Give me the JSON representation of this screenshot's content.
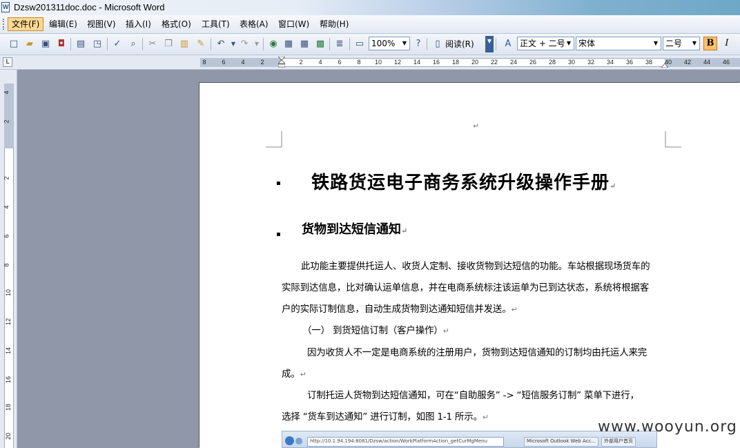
{
  "window": {
    "title": "Dzsw201311doc.doc - Microsoft Word"
  },
  "menu": [
    "文件(F)",
    "编辑(E)",
    "视图(V)",
    "插入(I)",
    "格式(O)",
    "工具(T)",
    "表格(A)",
    "窗口(W)",
    "帮助(H)"
  ],
  "toolbar": {
    "zoom": "100%",
    "read_label": "阅读(R)",
    "style": "正文 + 二号",
    "font": "宋体",
    "font_size": "二号",
    "bold_label": "B",
    "italic_label": "I"
  },
  "ruler": {
    "h_ticks": [
      "8",
      "6",
      "4",
      "2",
      "2",
      "4",
      "6",
      "8",
      "10",
      "12",
      "14",
      "16",
      "18",
      "20",
      "22",
      "24",
      "26",
      "28",
      "30",
      "32",
      "34",
      "36",
      "38",
      "40",
      "42",
      "44",
      "46"
    ],
    "v_ticks": [
      "4",
      "2",
      "2",
      "4",
      "6",
      "8",
      "10",
      "12",
      "14",
      "16",
      "18",
      "20"
    ]
  },
  "document": {
    "heading1": "铁路货运电子商务系统升级操作手册",
    "heading2": "货物到达短信通知",
    "lines": [
      "此功能主要提供托运人、收货人定制、接收货物到达短信的功能。车站根据现场货车的",
      "实际到达信息，比对确认运单信息，并在电商系统标注该运单为已到达状态，系统将根据客",
      "户的实际订制信息，自动生成货物到达通知短信并发送。",
      "（一）  到货短信订制（客户操作）",
      "因为收货人不一定是电商系统的注册用户，货物到达短信通知的订制均由托运人来完",
      "成。",
      "订制托运人货物到达短信通知，可在“自助服务” -> “短信服务订制” 菜单下进行，",
      "选择 “货车到达通知” 进行订制，如图 1-1 所示。"
    ],
    "embedded": {
      "address": "http://10.1.94.194:8081/Dzsw/action/WorkPlatformAction_getCurMgMenu",
      "tab1": "Microsoft Outlook Web Acc...",
      "tab2": "外部用户首页"
    }
  },
  "watermark": "www.wooyun.org"
}
